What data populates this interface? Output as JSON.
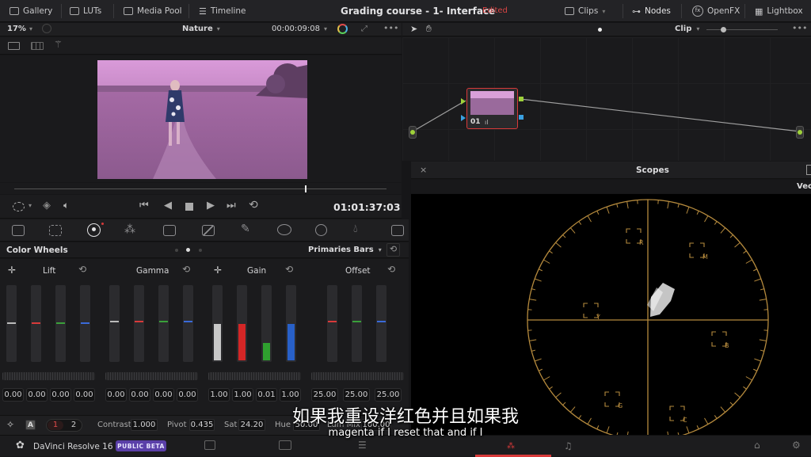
{
  "topbar": {
    "gallery": "Gallery",
    "luts": "LUTs",
    "media_pool": "Media Pool",
    "timeline": "Timeline",
    "project_title": "Grading course - 1- Interface",
    "edited": "Edited",
    "clips": "Clips",
    "nodes": "Nodes",
    "openfx": "OpenFX",
    "lightbox": "Lightbox"
  },
  "viewer": {
    "zoom": "17%",
    "clip_name": "Nature",
    "clip_timecode": "00:00:09:08",
    "playhead_fraction": 0.78,
    "record_timecode": "01:01:37:03"
  },
  "color_wheels": {
    "title": "Color Wheels",
    "mode": "Primaries Bars",
    "groups": [
      {
        "label": "Lift",
        "values": [
          "0.00",
          "0.00",
          "0.00",
          "0.00"
        ]
      },
      {
        "label": "Gamma",
        "values": [
          "0.00",
          "0.00",
          "0.00",
          "0.00"
        ]
      },
      {
        "label": "Gain",
        "values": [
          "1.00",
          "1.00",
          "0.01",
          "1.00"
        ]
      },
      {
        "label": "Offset",
        "values": [
          "25.00",
          "25.00",
          "25.00"
        ]
      }
    ]
  },
  "bottom_controls": {
    "tab_a": "A",
    "page1": "1",
    "page2": "2",
    "contrast_label": "Contrast",
    "contrast": "1.000",
    "pivot_label": "Pivot",
    "pivot": "0.435",
    "sat_label": "Sat",
    "sat": "24.20",
    "hue_label": "Hue",
    "hue": "50.00",
    "lummix_label": "Lum Mix",
    "lummix": "100.00"
  },
  "nodes_panel": {
    "mode": "Clip",
    "node_label": "01"
  },
  "scopes": {
    "title": "Scopes",
    "type": "Vec",
    "targets": [
      "R",
      "M",
      "Y",
      "B",
      "G",
      "C"
    ]
  },
  "statusbar": {
    "app_name": "DaVinci Resolve 16",
    "badge": "PUBLIC BETA"
  },
  "subtitles": {
    "chinese": "如果我重设洋红色并且如果我",
    "english": "magenta if I reset that and if I"
  },
  "colors": {
    "accent_red": "#d83a3a",
    "graticule": "#b58a3d",
    "badge": "#5a3fa8"
  }
}
